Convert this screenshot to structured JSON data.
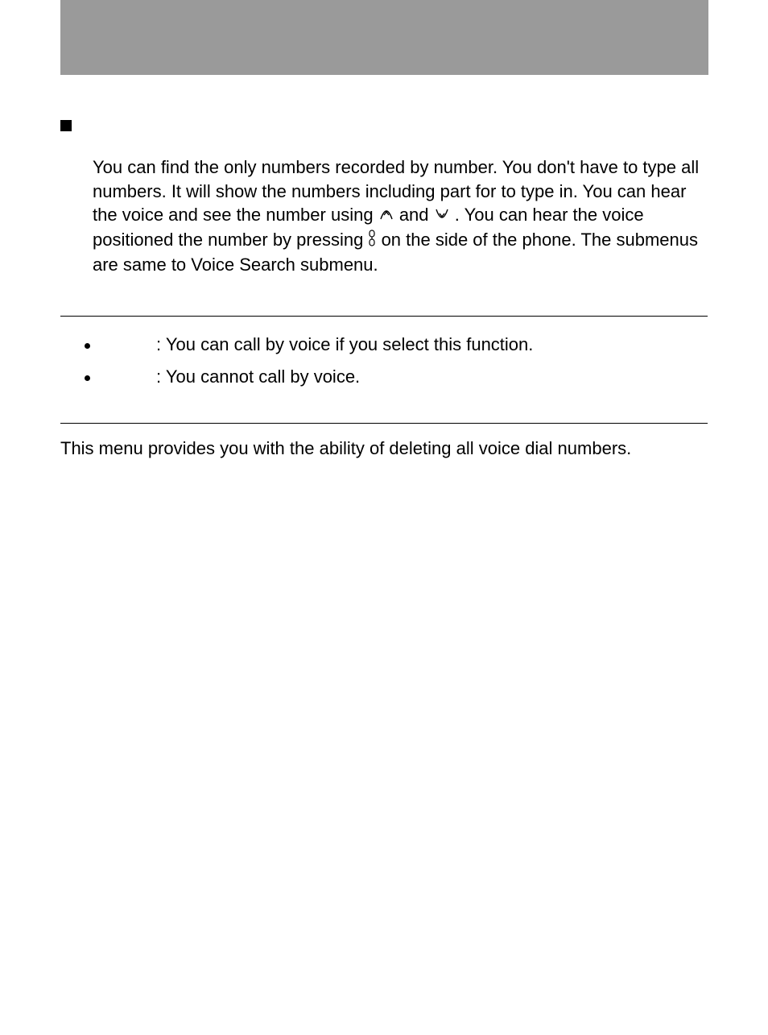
{
  "section1": {
    "p1": "You can find the only numbers recorded by number. You don't have to type all numbers. It will show the numbers including part for to type in. You can hear the voice and see the number using ",
    "p2": " and ",
    "p3": " . You can hear the voice positioned the number by pressing ",
    "p4": " on the side of the phone. The submenus are same to Voice Search submenu."
  },
  "options": [
    {
      "text": ": You can call by voice if you select this function."
    },
    {
      "text": ": You cannot call by voice."
    }
  ],
  "footer": "This menu provides you with the ability of deleting all voice dial numbers."
}
